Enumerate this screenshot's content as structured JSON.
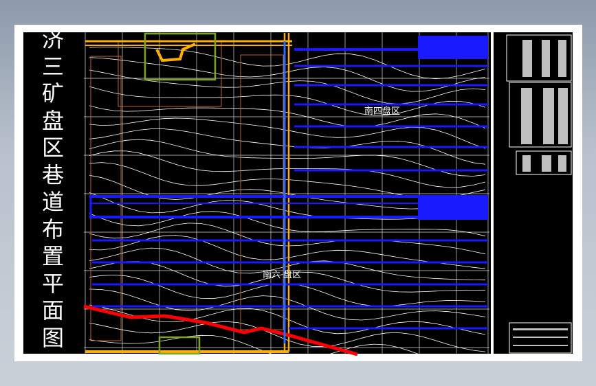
{
  "drawing": {
    "title_chars": [
      "济",
      "三",
      "矿",
      "盘",
      "区",
      "巷",
      "道",
      "布",
      "置",
      "平",
      "面",
      "图"
    ],
    "zones": {
      "south_four": "南四盘区",
      "south_six": "南六 盘区"
    }
  },
  "colors": {
    "background_gradient_top": "#8e9aab",
    "sheet": "#ffffff",
    "drawing": "#000000",
    "roadway": "#1a1aff",
    "main_shaft": "#ff0000",
    "boundary": "#ffb000",
    "grid": "#ffffff",
    "workface_box": "#7ea32a"
  }
}
